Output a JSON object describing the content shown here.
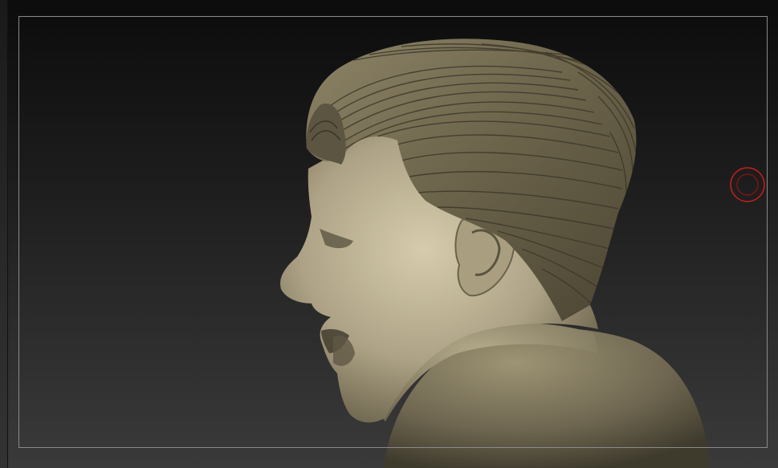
{
  "viewport": {
    "background_top": "#0c0c0c",
    "background_bottom": "#3a3a3a",
    "frame_color": "#8a8a8a"
  },
  "model": {
    "subject": "sculpted-head-profile",
    "skin_color": "#b3a88c",
    "hair_color": "#6e6550",
    "shoulder_color": "#746c52"
  },
  "cursor": {
    "icon": "brush-cursor-icon",
    "outer_color": "#c81e1e",
    "inner_color": "#7a1414"
  }
}
